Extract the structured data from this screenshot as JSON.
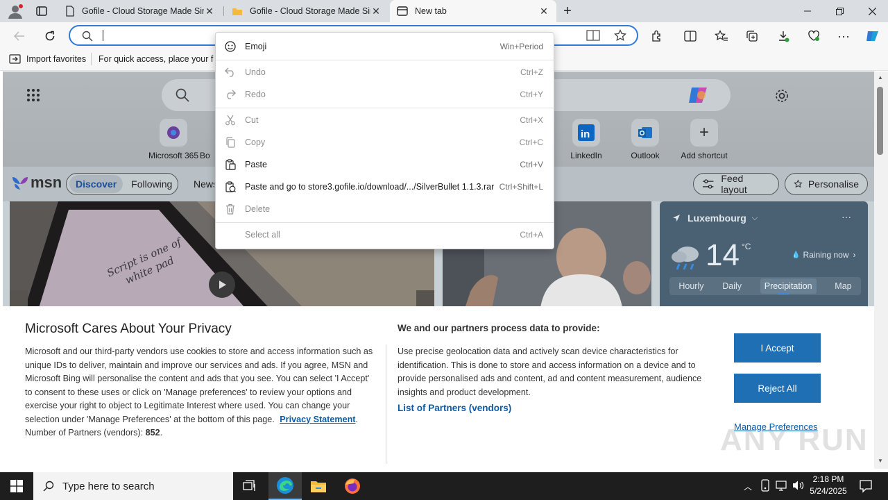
{
  "tabs": [
    {
      "title": "Gofile - Cloud Storage Made Simple"
    },
    {
      "title": "Gofile - Cloud Storage Made Simple"
    },
    {
      "title": "New tab"
    }
  ],
  "favorites": {
    "import_label": "Import favorites",
    "hint": "For quick access, place your favorites here on the favorites bar."
  },
  "context_menu": {
    "items": [
      {
        "label": "Emoji",
        "shortcut": "Win+Period",
        "icon": "emoji-icon"
      },
      {
        "label": "Undo",
        "shortcut": "Ctrl+Z",
        "icon": "undo-icon"
      },
      {
        "label": "Redo",
        "shortcut": "Ctrl+Y",
        "icon": "redo-icon"
      },
      {
        "label": "Cut",
        "shortcut": "Ctrl+X",
        "icon": "cut-icon"
      },
      {
        "label": "Copy",
        "shortcut": "Ctrl+C",
        "icon": "copy-icon"
      },
      {
        "label": "Paste",
        "shortcut": "Ctrl+V",
        "icon": "paste-icon"
      },
      {
        "label": "Paste and go to store3.gofile.io/download/.../SilverBullet 1.1.3.rar",
        "shortcut": "Ctrl+Shift+L",
        "icon": "paste-go-icon"
      },
      {
        "label": "Delete",
        "shortcut": "",
        "icon": "delete-icon"
      },
      {
        "label": "Select all",
        "shortcut": "Ctrl+A",
        "icon": ""
      }
    ]
  },
  "shortcuts": [
    {
      "label": "Microsoft 365"
    },
    {
      "label": "Bo"
    },
    {
      "label": "LinkedIn"
    },
    {
      "label": "Outlook"
    },
    {
      "label": "Add shortcut"
    }
  ],
  "msn": {
    "logo": "msn",
    "tabs": [
      "Discover",
      "Following",
      "News"
    ],
    "feed_layout": "Feed layout",
    "personalise": "Personalise"
  },
  "feed_card": {
    "lines": [
      "Script is one of",
      "white pad"
    ]
  },
  "weather": {
    "location": "Luxembourg",
    "temp": "14",
    "unit": "°C",
    "status": "Raining now",
    "tabs": [
      "Hourly",
      "Daily",
      "Precipitation",
      "Map"
    ]
  },
  "cookie": {
    "title": "Microsoft Cares About Your Privacy",
    "body": "Microsoft and our third-party vendors use cookies to store and access information such as unique IDs to deliver, maintain and improve our services and ads. If you agree, MSN and Microsoft Bing will personalise the content and ads that you see. You can select 'I Accept' to consent to these uses or click on 'Manage preferences' to review your options and exercise your right to object to Legitimate Interest where used.  You can change your selection under 'Manage Preferences' at the bottom of this page.",
    "privacy_link": "Privacy Statement",
    "partners_label": "Number of Partners (vendors):",
    "partners_count": "852",
    "right_title": "We and our partners process data to provide:",
    "right_body": "Use precise geolocation data and actively scan device characteristics for identification. This is done to store and access information on a device and to provide personalised ads and content, ad and content measurement, audience insights and product development.",
    "partners_link": "List of Partners (vendors)",
    "accept": "I Accept",
    "reject": "Reject All",
    "manage": "Manage Preferences"
  },
  "watermark": "ANY RUN",
  "taskbar": {
    "search_placeholder": "Type here to search",
    "time": "2:18 PM",
    "date": "5/24/2025"
  },
  "colors": {
    "accent": "#1f6fb5",
    "address_border": "#2f7ad8",
    "link": "#0b5ca8"
  }
}
